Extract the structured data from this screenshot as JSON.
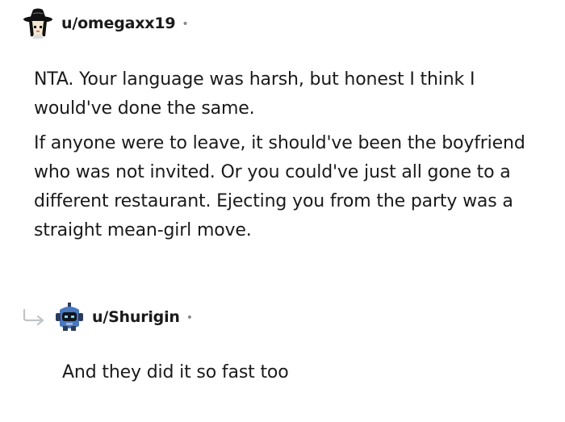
{
  "comments": [
    {
      "username": "u/omegaxx19",
      "separator": "•",
      "avatar_icon": "witch-hat-avatar-icon",
      "paragraphs": [
        "NTA. Your language was harsh, but honest I think I would've done the same.",
        "If anyone were to leave, it should've been the boyfriend who was not invited. Or you could've just all gone to a different restaurant. Ejecting you from the party was a straight mean-girl move."
      ]
    }
  ],
  "reply": {
    "username": "u/Shurigin",
    "separator": "•",
    "avatar_icon": "robot-avatar-icon",
    "thread_icon": "reply-arrow-icon",
    "text": "And they did it so fast too"
  },
  "colors": {
    "text": "#1a1a1b",
    "muted": "#878a8c",
    "arrow": "#c1c4c6",
    "robot_blue": "#4a78c0"
  }
}
